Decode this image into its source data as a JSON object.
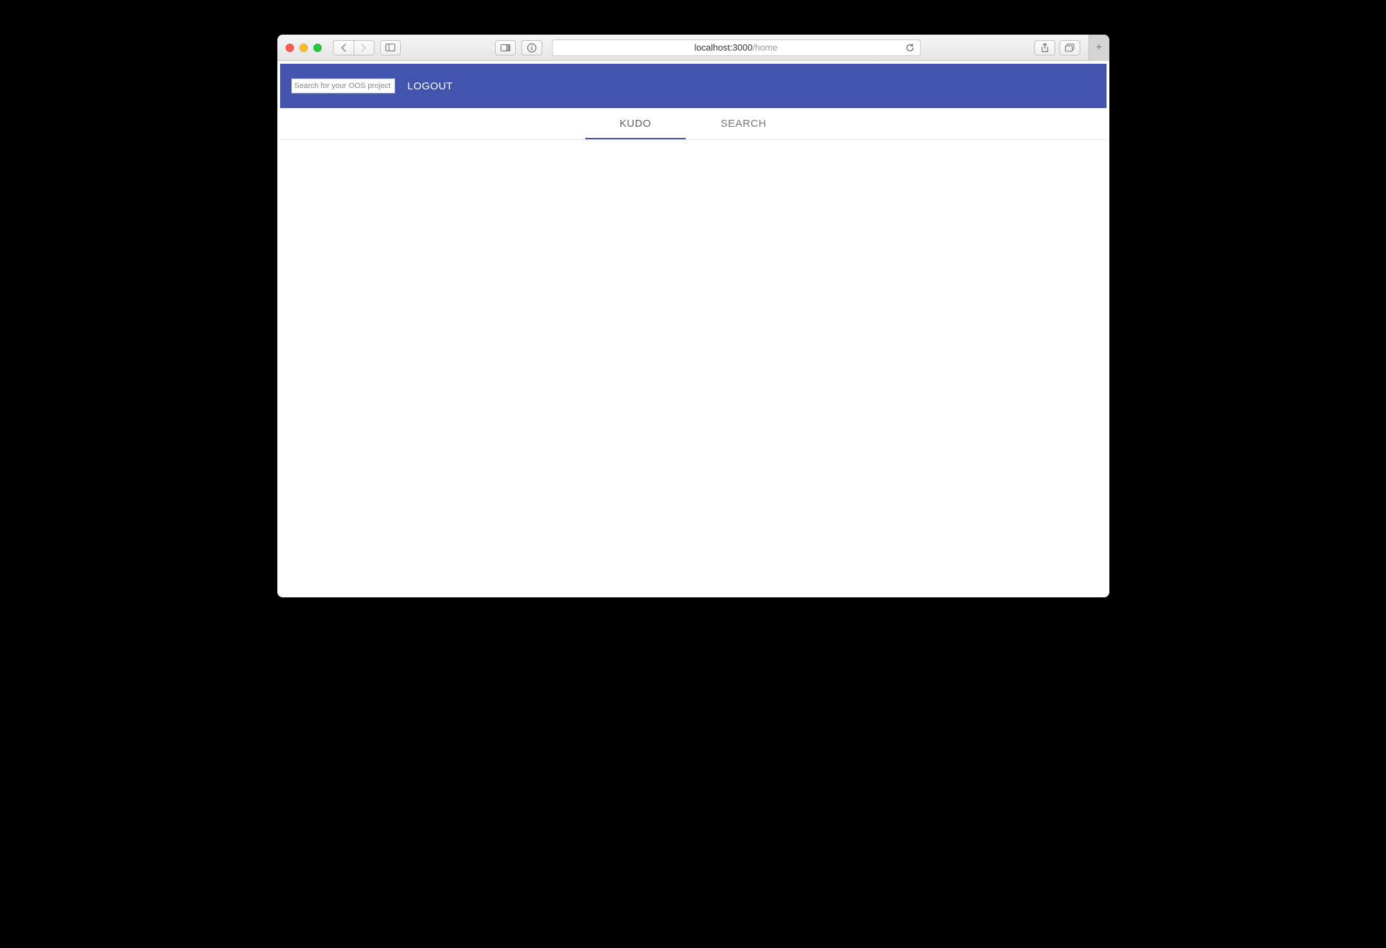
{
  "browser": {
    "address_host": "localhost:3000",
    "address_path": "/home"
  },
  "header": {
    "search_placeholder": "Search for your OOS project",
    "logout_label": "LOGOUT"
  },
  "tabs": {
    "items": [
      {
        "label": "KUDO",
        "active": true
      },
      {
        "label": "SEARCH",
        "active": false
      }
    ]
  }
}
